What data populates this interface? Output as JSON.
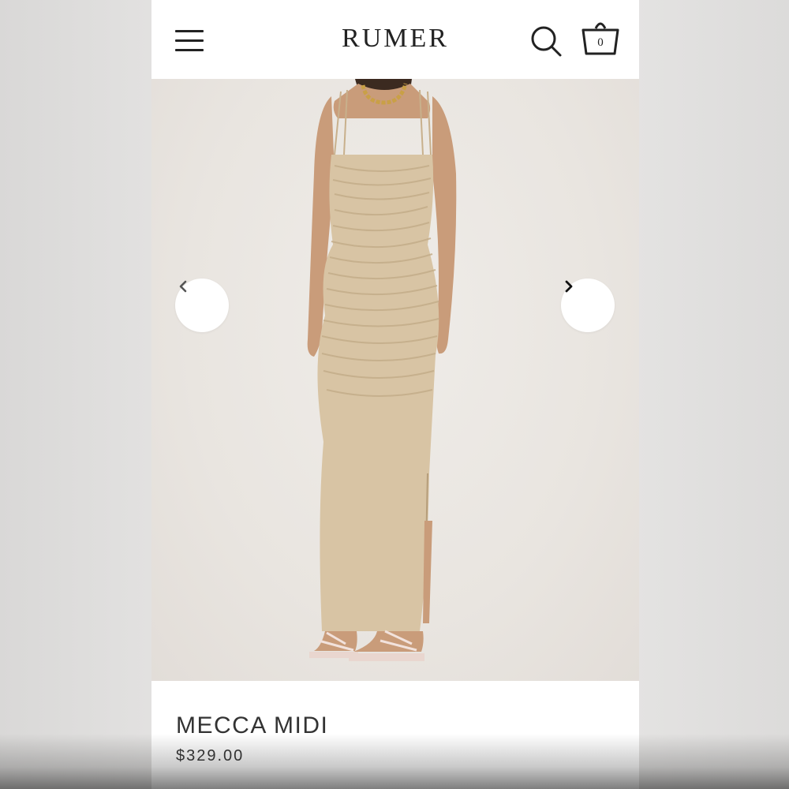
{
  "header": {
    "logo": "RUMER",
    "menu_icon": "hamburger-menu-icon",
    "search_icon": "search-icon",
    "cart_icon": "basket-icon",
    "cart_count": "0"
  },
  "gallery": {
    "prev_icon": "chevron-left-icon",
    "next_icon": "chevron-right-icon"
  },
  "product": {
    "name": "MECCA MIDI",
    "price": "$329.00"
  },
  "colors": {
    "dress": "#d8c4a4",
    "background": "#ece9e5",
    "text": "#333333"
  }
}
